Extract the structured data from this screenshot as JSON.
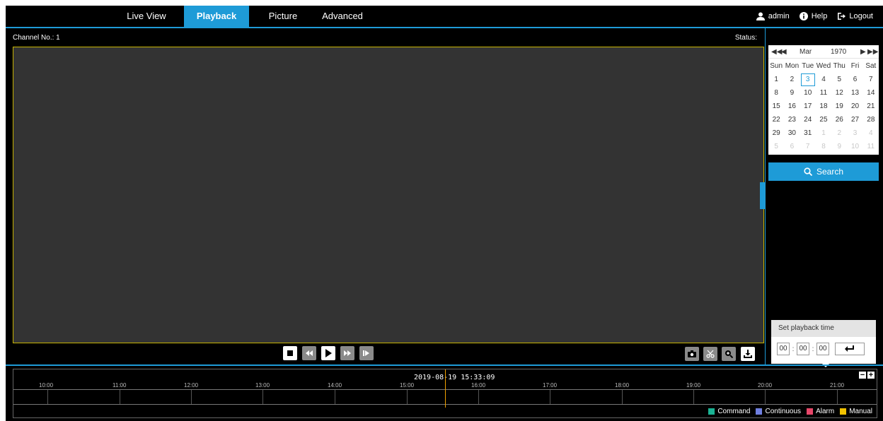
{
  "nav": {
    "tabs": [
      {
        "label": "Live View"
      },
      {
        "label": "Playback"
      },
      {
        "label": "Picture"
      },
      {
        "label": "Advanced"
      }
    ],
    "user": "admin",
    "help": "Help",
    "logout": "Logout"
  },
  "main": {
    "channel_label": "Channel No.: 1",
    "status_label": "Status:"
  },
  "calendar": {
    "month": "Mar",
    "year": "1970",
    "weekdays": [
      "Sun",
      "Mon",
      "Tue",
      "Wed",
      "Thu",
      "Fri",
      "Sat"
    ],
    "weeks": [
      [
        "1",
        "2",
        "3",
        "4",
        "5",
        "6",
        "7"
      ],
      [
        "8",
        "9",
        "10",
        "11",
        "12",
        "13",
        "14"
      ],
      [
        "15",
        "16",
        "17",
        "18",
        "19",
        "20",
        "21"
      ],
      [
        "22",
        "23",
        "24",
        "25",
        "26",
        "27",
        "28"
      ],
      [
        "29",
        "30",
        "31",
        "1",
        "2",
        "3",
        "4"
      ],
      [
        "5",
        "6",
        "7",
        "8",
        "9",
        "10",
        "11"
      ]
    ],
    "selected_day": "3"
  },
  "search": {
    "label": "Search"
  },
  "playback_time": {
    "title": "Set playback time",
    "hh": "00",
    "mm": "00",
    "ss": "00"
  },
  "timeline": {
    "current_time": "2019-08-19 15:33:09",
    "hours": [
      "10:00",
      "11:00",
      "12:00",
      "13:00",
      "14:00",
      "15:00",
      "16:00",
      "17:00",
      "18:00",
      "19:00",
      "20:00",
      "21:00"
    ],
    "legend": [
      {
        "label": "Command",
        "color": "#1bb394"
      },
      {
        "label": "Continuous",
        "color": "#6f7fe0"
      },
      {
        "label": "Alarm",
        "color": "#e8476a"
      },
      {
        "label": "Manual",
        "color": "#f2c200"
      }
    ]
  },
  "colors": {
    "accent": "#1e9bd7",
    "video_border": "#c8b400",
    "cursor": "#f0a000"
  }
}
